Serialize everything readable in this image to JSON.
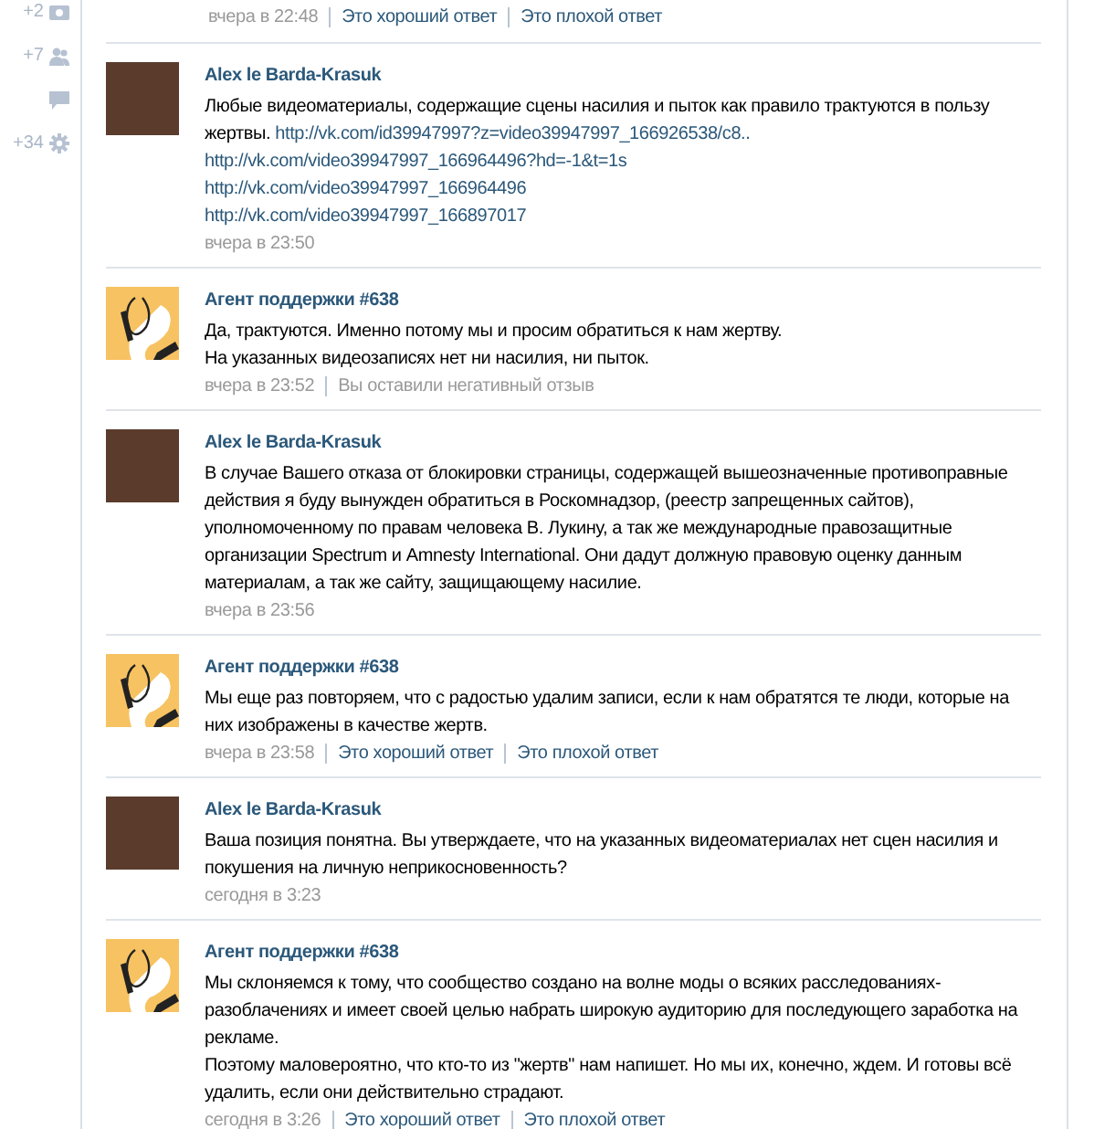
{
  "sidebar": {
    "items": [
      {
        "count": "+2",
        "kind": "photo"
      },
      {
        "count": "+7",
        "kind": "people"
      },
      {
        "kind": "comment"
      },
      {
        "count": "+34",
        "kind": "gear"
      }
    ]
  },
  "messages": [
    {
      "footer": {
        "time": "вчера в 22:48",
        "actions": [
          {
            "kind": "link",
            "text": "Это хороший ответ"
          },
          {
            "kind": "link",
            "text": "Это плохой ответ"
          }
        ]
      }
    },
    {
      "author": "Alex le Barda-Krasuk",
      "kind": "user",
      "paragraphs": [
        [
          {
            "kind": "text",
            "text": "Любые видеоматериалы, содержащие сцены насилия и пыток как правило трактуются в пользу жертвы."
          },
          {
            "kind": "link",
            "text": "http://vk.com/id39947997?z=video39947997_166926538/c8.."
          }
        ],
        [
          {
            "kind": "link",
            "text": "http://vk.com/video39947997_166964496?hd=-1&t=1s"
          }
        ],
        [
          {
            "kind": "link",
            "text": "http://vk.com/video39947997_166964496"
          }
        ],
        [
          {
            "kind": "link",
            "text": "http://vk.com/video39947997_166897017"
          }
        ]
      ],
      "footer": {
        "time": "вчера в 23:50"
      }
    },
    {
      "author": "Агент поддержки #638",
      "kind": "agent",
      "paragraphs": [
        [
          {
            "kind": "text",
            "text": "Да, трактуются. Именно потому мы и просим обратиться к нам жертву."
          }
        ],
        [
          {
            "kind": "text",
            "text": "На указанных видеозаписях нет ни насилия, ни пыток."
          }
        ]
      ],
      "footer": {
        "time": "вчера в 23:52",
        "actions": [
          {
            "kind": "note",
            "text": "Вы оставили негативный отзыв"
          }
        ]
      }
    },
    {
      "author": "Alex le Barda-Krasuk",
      "kind": "user",
      "paragraphs": [
        [
          {
            "kind": "text",
            "text": "В случае Вашего отказа от блокировки страницы, содержащей вышеозначенные противоправные действия я буду вынужден обратиться в Роскомнадзор, (реестр запрещенных сайтов), уполномоченному по правам человека В. Лукину, а так же международные правозащитные организации Spectrum и Amnesty International. Они дадут должную правовую оценку данным материалам, а так же сайту, защищающему насилие."
          }
        ]
      ],
      "footer": {
        "time": "вчера в 23:56"
      }
    },
    {
      "author": "Агент поддержки #638",
      "kind": "agent",
      "paragraphs": [
        [
          {
            "kind": "text",
            "text": "Мы еще раз повторяем, что с радостью удалим записи, если к нам обратятся те люди, которые на них изображены в качестве жертв."
          }
        ]
      ],
      "footer": {
        "time": "вчера в 23:58",
        "actions": [
          {
            "kind": "link",
            "text": "Это хороший ответ"
          },
          {
            "kind": "link",
            "text": "Это плохой ответ"
          }
        ]
      }
    },
    {
      "author": "Alex le Barda-Krasuk",
      "kind": "user",
      "paragraphs": [
        [
          {
            "kind": "text",
            "text": "Ваша позиция понятна. Вы утверждаете, что на указанных видеоматериалах нет сцен насилия и покушения на личную неприкосновенность?"
          }
        ]
      ],
      "footer": {
        "time": "сегодня в 3:23"
      }
    },
    {
      "author": "Агент поддержки #638",
      "kind": "agent",
      "paragraphs": [
        [
          {
            "kind": "text",
            "text": "Мы склоняемся к тому, что сообщество создано на волне моды о всяких расследованиях-разоблачениях и имеет своей целью набрать широкую аудиторию для последующего заработка на рекламе."
          }
        ],
        [
          {
            "kind": "text",
            "text": "Поэтому маловероятно, что кто-то из \"жертв\" нам напишет. Но мы их, конечно, ждем. И готовы всё удалить, если они действительно страдают."
          }
        ]
      ],
      "footer": {
        "time": "сегодня в 3:26",
        "actions": [
          {
            "kind": "link",
            "text": "Это хороший ответ"
          },
          {
            "kind": "link",
            "text": "Это плохой ответ"
          }
        ]
      }
    }
  ]
}
